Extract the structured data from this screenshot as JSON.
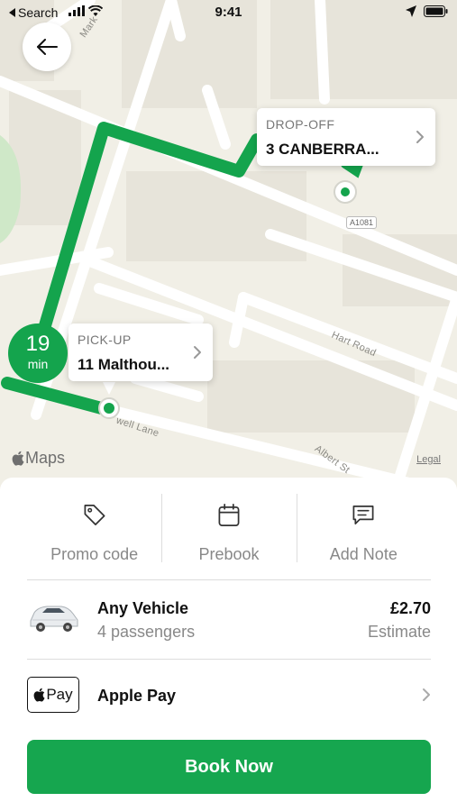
{
  "status_bar": {
    "back_app": "Search",
    "time": "9:41"
  },
  "map": {
    "streets": [
      "Mark",
      "Hart Road",
      "well Lane",
      "Albert St"
    ],
    "road_number": "A1081",
    "brand": "Maps",
    "legal": "Legal",
    "route_color": "#14a44d"
  },
  "dropoff": {
    "caption": "DROP-OFF",
    "address": "3 CANBERRA..."
  },
  "pickup": {
    "caption": "PICK-UP",
    "address": "11 Malthou..."
  },
  "eta": {
    "value": "19",
    "unit": "min"
  },
  "options": [
    {
      "label": "Promo code",
      "icon": "tag-icon"
    },
    {
      "label": "Prebook",
      "icon": "calendar-icon"
    },
    {
      "label": "Add Note",
      "icon": "note-icon"
    }
  ],
  "vehicle": {
    "name": "Any Vehicle",
    "passengers": "4 passengers",
    "price": "£2.70",
    "price_note": "Estimate"
  },
  "payment": {
    "badge_text": "Pay",
    "label": "Apple Pay"
  },
  "book_button": {
    "label": "Book Now",
    "color": "#16a64f"
  }
}
